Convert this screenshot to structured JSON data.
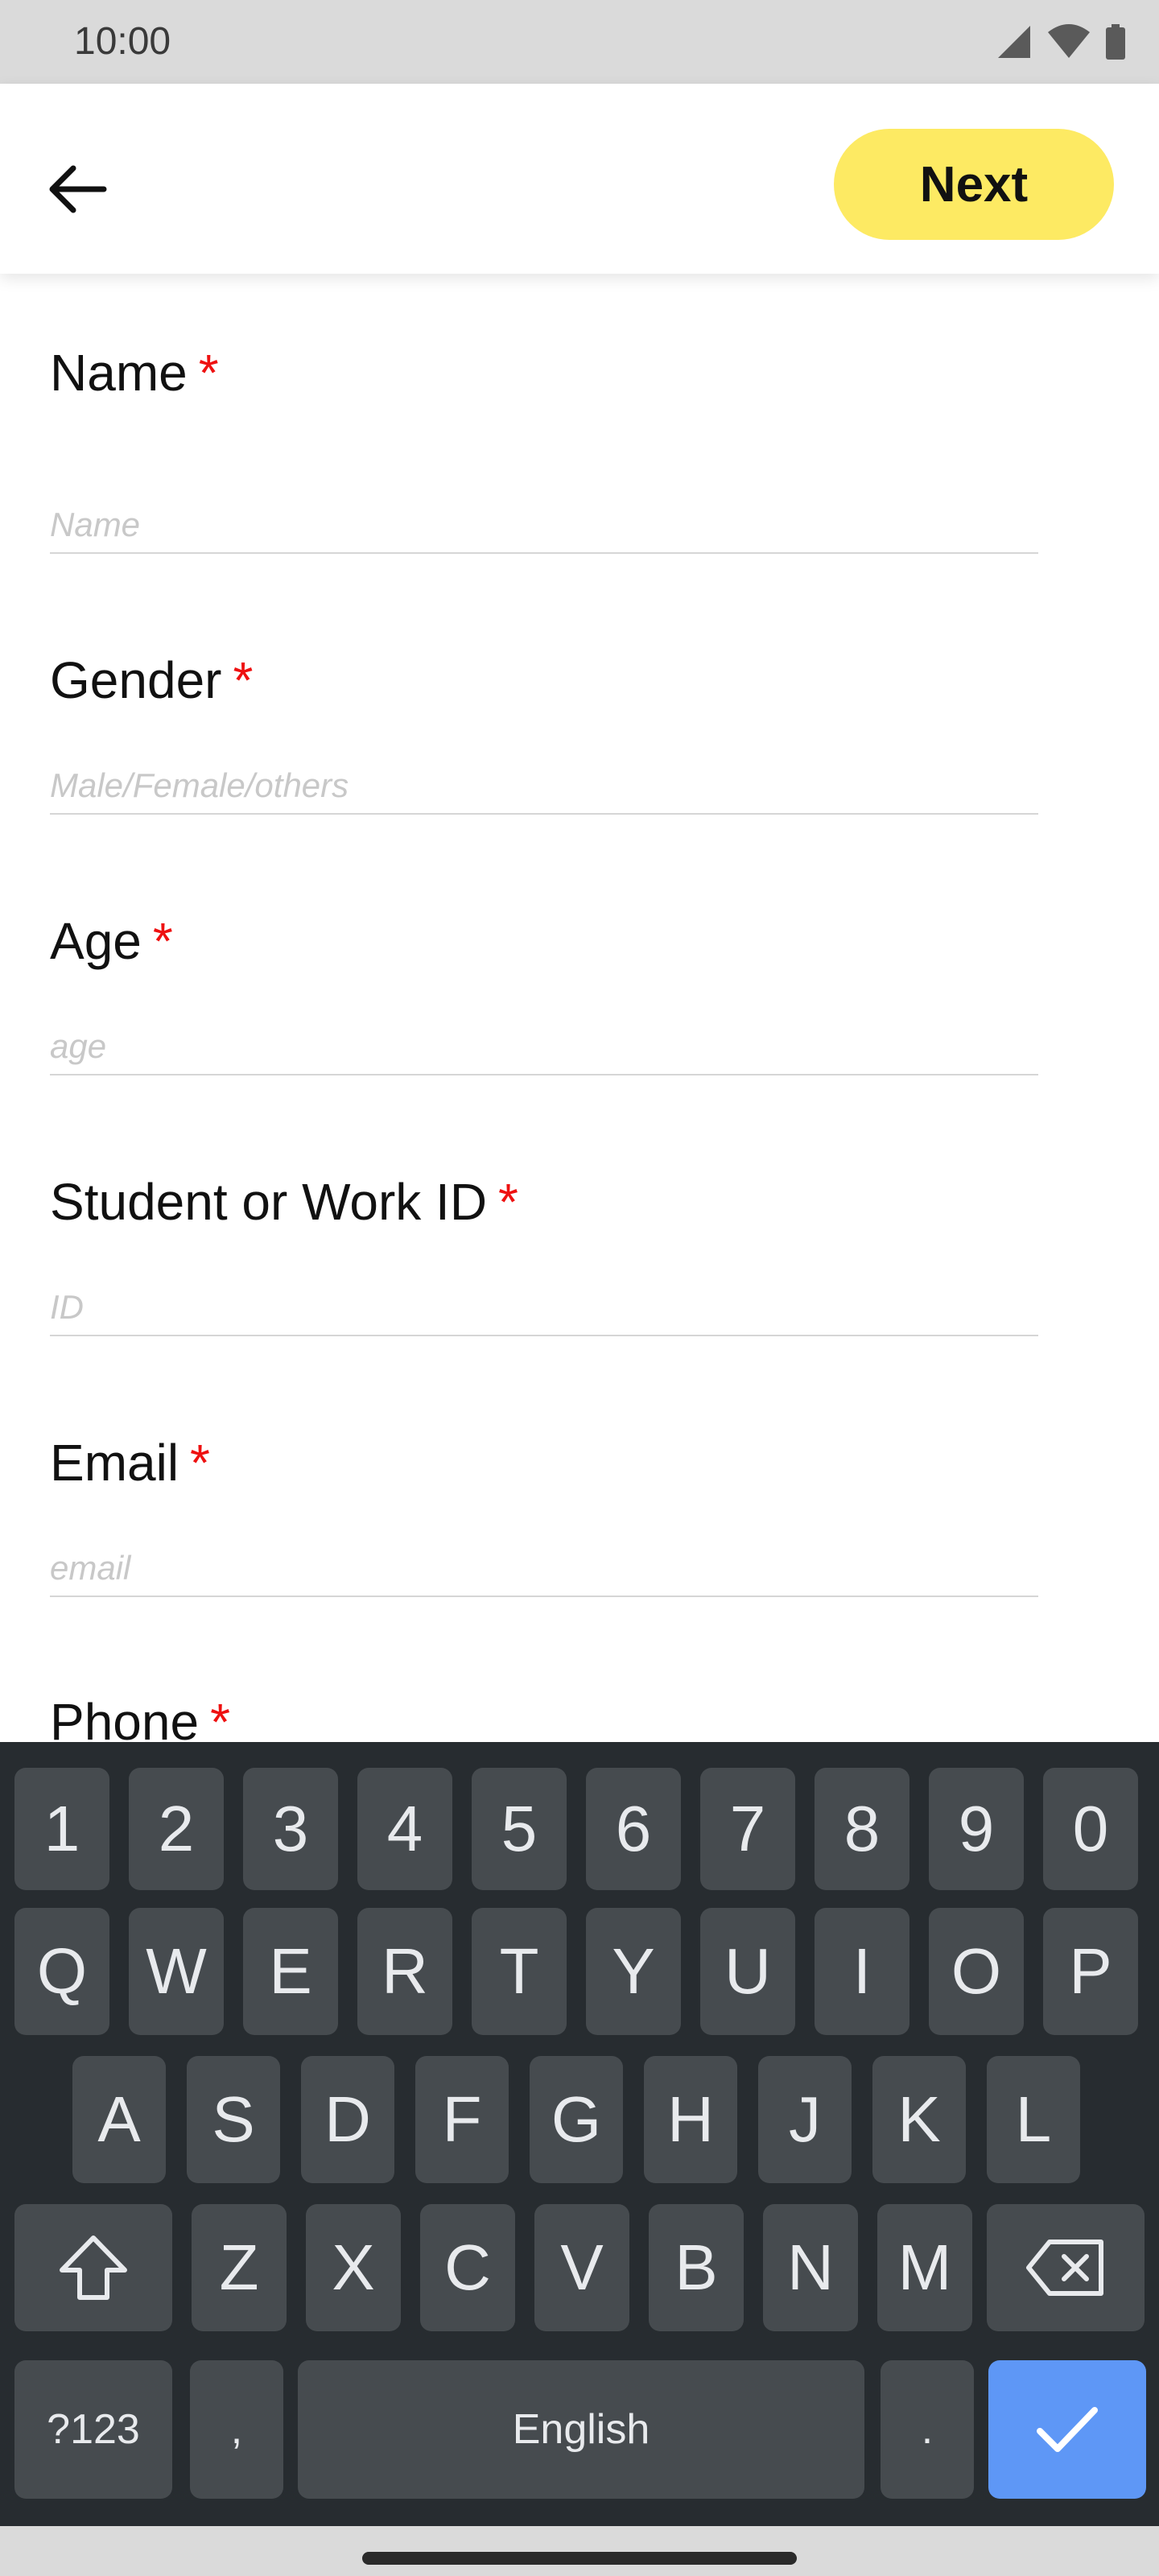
{
  "status_bar": {
    "time": "10:00"
  },
  "app_bar": {
    "next_label": "Next"
  },
  "form": {
    "fields": [
      {
        "label": "Name",
        "required": "*",
        "placeholder": "Name"
      },
      {
        "label": "Gender",
        "required": "*",
        "placeholder": "Male/Female/others"
      },
      {
        "label": "Age",
        "required": "*",
        "placeholder": "age"
      },
      {
        "label": "Student or Work ID",
        "required": "*",
        "placeholder": "ID"
      },
      {
        "label": "Email",
        "required": "*",
        "placeholder": "email"
      },
      {
        "label": "Phone",
        "required": "*"
      }
    ]
  },
  "keyboard": {
    "row_numbers": [
      "1",
      "2",
      "3",
      "4",
      "5",
      "6",
      "7",
      "8",
      "9",
      "0"
    ],
    "row_top": [
      "Q",
      "W",
      "E",
      "R",
      "T",
      "Y",
      "U",
      "I",
      "O",
      "P"
    ],
    "row_middle": [
      "A",
      "S",
      "D",
      "F",
      "G",
      "H",
      "J",
      "K",
      "L"
    ],
    "row_bottom": [
      "Z",
      "X",
      "C",
      "V",
      "B",
      "N",
      "M"
    ],
    "symbols_label": "?123",
    "comma_label": ",",
    "space_label": "English",
    "period_label": ".",
    "shift_icon": "shift-icon",
    "backspace_icon": "backspace-icon",
    "enter_icon": "checkmark-icon",
    "enter_color": "#5e97f6"
  },
  "colors": {
    "accent": "#fdea63",
    "required": "#ee1111",
    "keyboard_bg": "#272c30",
    "key_bg": "#464b4f"
  }
}
